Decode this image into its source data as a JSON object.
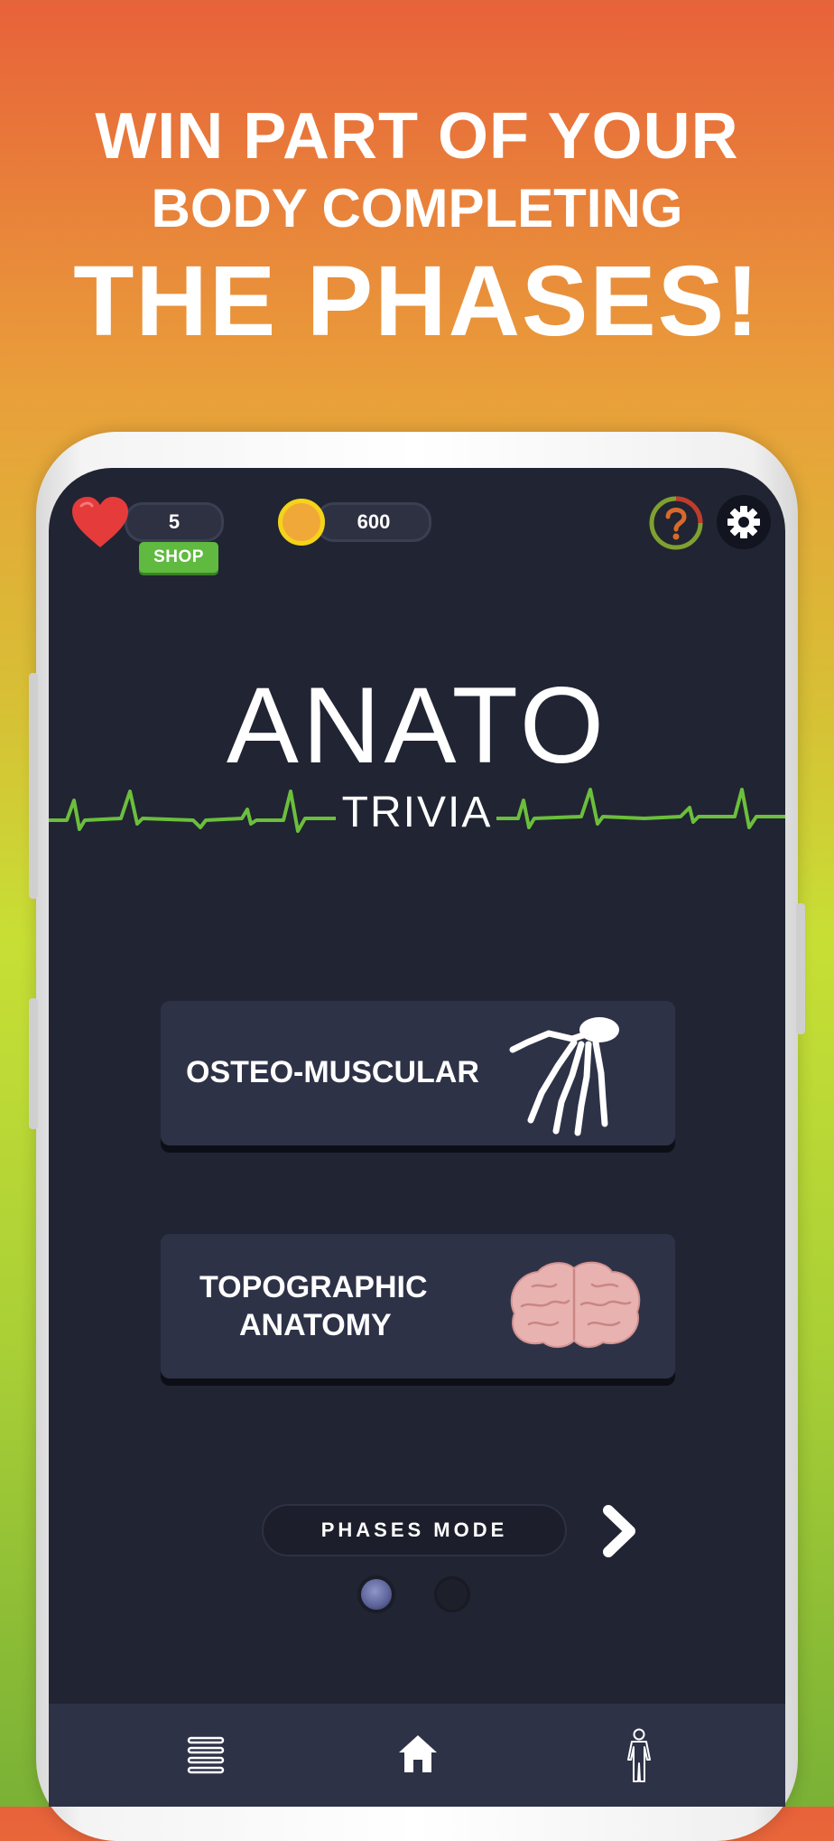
{
  "headline": {
    "line1": "WIN PART OF YOUR",
    "line2": "BODY COMPLETING",
    "line3": "THE PHASES!"
  },
  "topbar": {
    "lives": "5",
    "shop_label": "SHOP",
    "coins": "600",
    "help_icon": "question-icon",
    "settings_icon": "gear-icon"
  },
  "logo": {
    "title": "ANATO",
    "subtitle": "TRIVIA"
  },
  "categories": [
    {
      "label": "OSTEO-MUSCULAR",
      "icon": "hand-skeleton-icon"
    },
    {
      "label_line1": "TOPOGRAPHIC",
      "label_line2": "ANATOMY",
      "icon": "brain-icon"
    }
  ],
  "mode": {
    "label": "PHASES MODE",
    "next_icon": "chevron-right-icon"
  },
  "pagination": {
    "current": 1,
    "total": 2
  },
  "bottom_nav": [
    {
      "icon": "menu-icon"
    },
    {
      "icon": "home-icon"
    },
    {
      "icon": "body-icon"
    }
  ],
  "colors": {
    "screen_bg": "#212432",
    "card_bg": "#2e3247",
    "accent_green": "#5fba3f",
    "heart_red": "#e53b3b",
    "coin_gold": "#f0a938"
  }
}
